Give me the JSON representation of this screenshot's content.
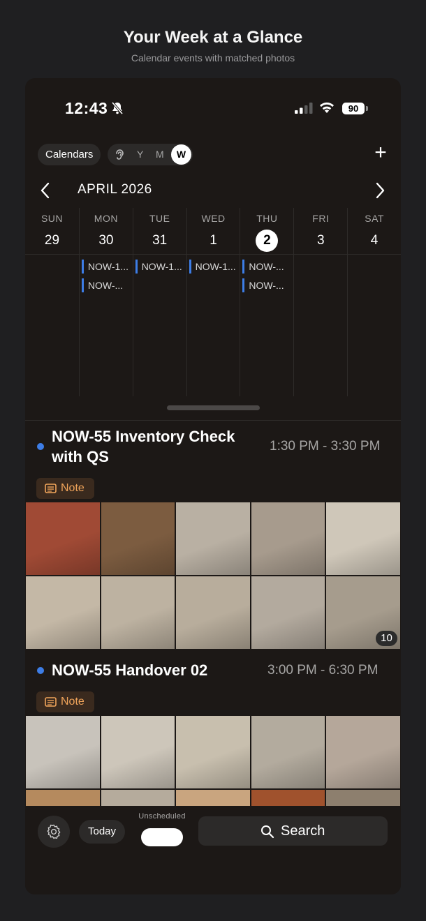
{
  "promo": {
    "title": "Your Week at a Glance",
    "subtitle": "Calendar events with matched photos"
  },
  "status_bar": {
    "time": "12:43",
    "battery": "90",
    "icons": [
      "bell-slash-icon",
      "signal-icon",
      "wifi-icon",
      "battery-icon"
    ]
  },
  "toolbar": {
    "calendars_label": "Calendars",
    "view_modes": [
      "Y",
      "M",
      "W"
    ],
    "selected_view": "W",
    "add_label": "+"
  },
  "calendar": {
    "month_label": "APRIL 2026",
    "days": [
      {
        "dow": "SUN",
        "num": "29",
        "today": false,
        "events": []
      },
      {
        "dow": "MON",
        "num": "30",
        "today": false,
        "events": [
          "NOW-1...",
          "NOW-..."
        ]
      },
      {
        "dow": "TUE",
        "num": "31",
        "today": false,
        "events": [
          "NOW-1..."
        ]
      },
      {
        "dow": "WED",
        "num": "1",
        "today": false,
        "events": [
          "NOW-1..."
        ]
      },
      {
        "dow": "THU",
        "num": "2",
        "today": true,
        "events": [
          "NOW-...",
          "NOW-..."
        ]
      },
      {
        "dow": "FRI",
        "num": "3",
        "today": false,
        "events": []
      },
      {
        "dow": "SAT",
        "num": "4",
        "today": false,
        "events": []
      }
    ],
    "event_color": "#3d7de6"
  },
  "events": [
    {
      "title_line1": "NOW-55 Inventory Check",
      "title_line2": "with QS",
      "time": "1:30 PM - 3:30 PM",
      "note_label": "Note",
      "photo_count_badge": "10",
      "photo_tones": [
        "#a04a35",
        "#7c5c40",
        "#b9b0a3",
        "#a79b8d",
        "#cfc7b9",
        "#c4b8a6",
        "#bdb2a1",
        "#b8ad9c",
        "#b3aa9e",
        "#a69c8d"
      ]
    },
    {
      "title_line1": "NOW-55 Handover 02",
      "title_line2": "",
      "time": "3:00 PM - 6:30 PM",
      "note_label": "Note",
      "photo_tones": [
        "#c8c3bb",
        "#cdc6ba",
        "#c8bfae",
        "#b3ab9e",
        "#b5a79a",
        "#b58a5e",
        "#b5ab9c",
        "#c9a57f",
        "#a0522d",
        "#8d7f6e"
      ]
    }
  ],
  "bottom_bar": {
    "today_label": "Today",
    "unscheduled_label": "Unscheduled",
    "search_label": "Search"
  }
}
